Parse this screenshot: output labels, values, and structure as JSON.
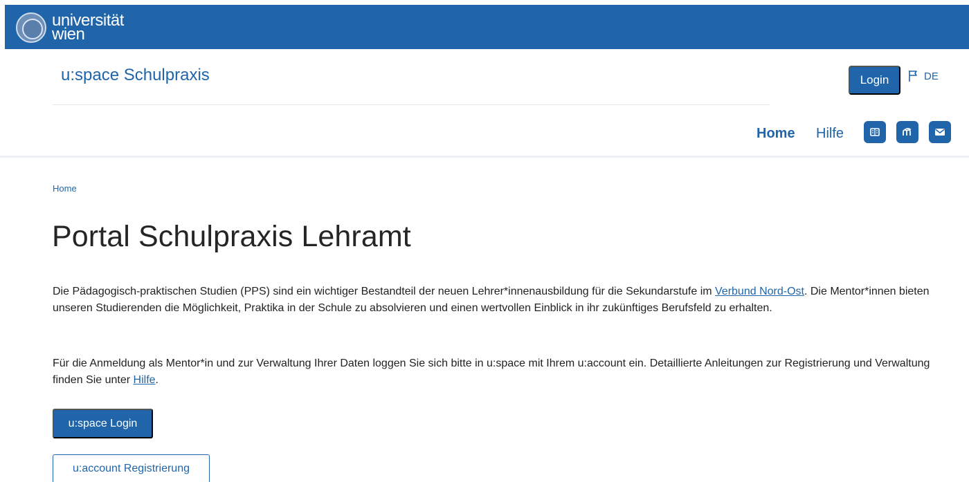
{
  "brand": {
    "line1": "universität",
    "line2": "wien",
    "seal_icon": "university-seal-icon"
  },
  "header": {
    "site_title": "u:space Schulpraxis",
    "login_label": "Login",
    "language": "DE",
    "language_icon": "flag-icon"
  },
  "nav": {
    "home_label": "Home",
    "help_label": "Hilfe",
    "icons": [
      "reader-icon",
      "moodle-icon",
      "mail-icon"
    ]
  },
  "breadcrumb": {
    "current": "Home"
  },
  "page": {
    "title": "Portal Schulpraxis Lehramt",
    "intro_before": "Die Pädagogisch-praktischen Studien (PPS) sind ein wichtiger Bestandteil der neuen Lehrer*innenausbildung für die Sekundarstufe im ",
    "intro_link": "Verbund Nord-Ost",
    "intro_after": ". Die Mentor*innen bieten unseren Studierenden die Möglichkeit, Praktika in der Schule zu absolvieren und einen wertvollen Einblick in ihr zukünftiges Berufsfeld zu erhalten.",
    "login_before": "Für die Anmeldung als Mentor*in und zur Verwaltung Ihrer Daten loggen Sie sich bitte in u:space mit Ihrem u:account ein. Detaillierte Anleitungen zur Registrierung und Verwaltung finden Sie unter ",
    "login_link": "Hilfe",
    "login_after": ".",
    "primary_button": "u:space Login",
    "secondary_button": "u:account Registrierung"
  },
  "colors": {
    "brand_blue": "#2065aa",
    "text": "#222222",
    "divider": "#e4e8ee"
  }
}
